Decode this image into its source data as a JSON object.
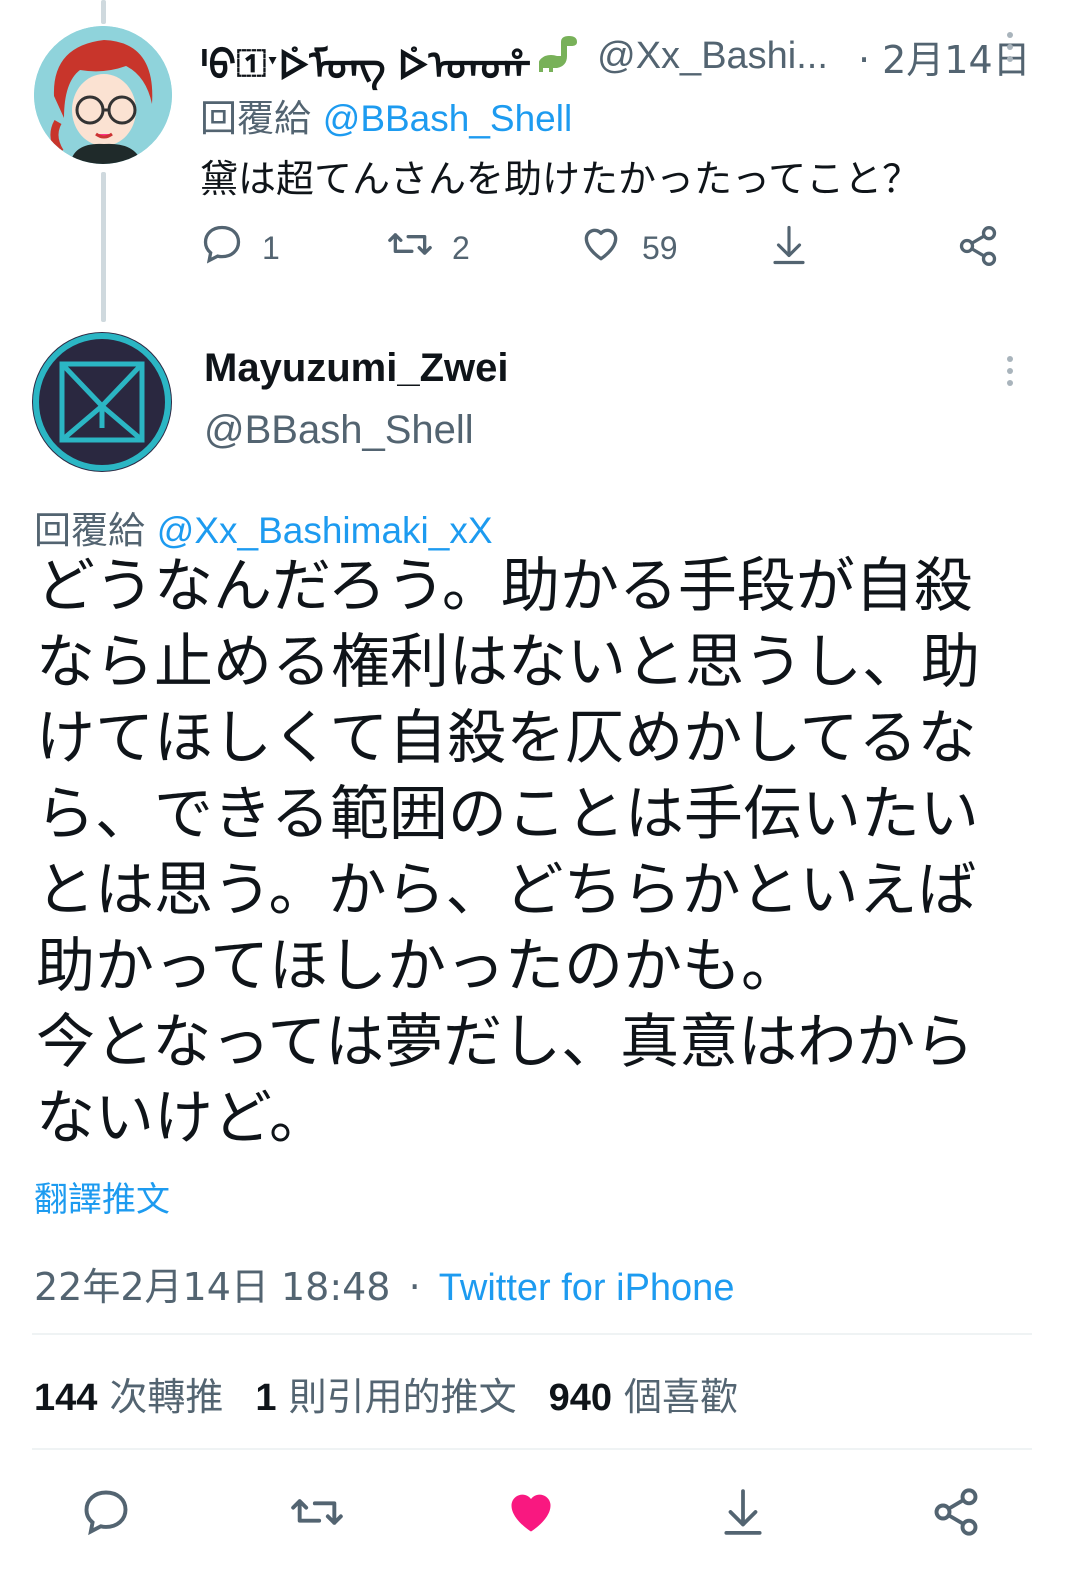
{
  "reply_tweet": {
    "display_name": "ˡᠪ᠋ˑᢰᠮᠣᠩ ᢰᠣᠣ᠋ᡥ",
    "display_name_emoji": "🦕",
    "handle": "@Xx_Bashi...",
    "time": "· 2月14日",
    "reply_to_prefix": "回覆給",
    "reply_to_handle": "@BBash_Shell",
    "text": "黛は超てんさんを助けたかったってこと？",
    "replies": "1",
    "retweets": "2",
    "likes": "59"
  },
  "main_tweet": {
    "display_name": "Mayuzumi_Zwei",
    "handle": "@BBash_Shell",
    "reply_to_prefix": "回覆給",
    "reply_to_handle": "@Xx_Bashimaki_xX",
    "text": "どうなんだろう。助かる手段が自殺なら止める権利はないと思うし、助けてほしくて自殺を仄めかしてるなら、できる範囲のことは手伝いたいとは思う。から、どちらかといえば助かってほしかったのかも。\n今となっては夢だし、真意はわからないけど。",
    "translate_label": "翻譯推文",
    "timestamp": "22年2月14日 18:48",
    "timestamp_separator": "·",
    "source": "Twitter for iPhone",
    "retweet_count": "144",
    "retweet_label": "次轉推",
    "quote_count": "1",
    "quote_label": "則引用的推文",
    "like_count": "940",
    "like_label": "個喜歡"
  },
  "colors": {
    "accent": "#1d9bf0",
    "like": "#f91880",
    "muted": "#536471",
    "thread_line": "#cfd9de"
  },
  "icons": [
    "reply-icon",
    "retweet-icon",
    "heart-icon",
    "share-download-icon",
    "share-icon",
    "more-icon"
  ]
}
